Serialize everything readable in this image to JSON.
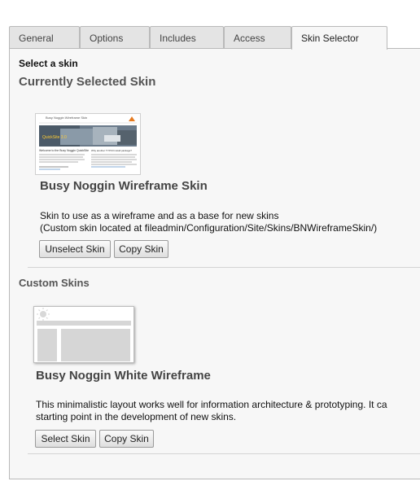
{
  "tabs": [
    {
      "label": "General",
      "active": false
    },
    {
      "label": "Options",
      "active": false
    },
    {
      "label": "Includes",
      "active": false
    },
    {
      "label": "Access",
      "active": false
    },
    {
      "label": "Skin Selector",
      "active": true
    }
  ],
  "panel": {
    "select_label": "Select a skin",
    "current_heading": "Currently Selected Skin",
    "current_skin": {
      "title": "Busy Noggin Wireframe Skin",
      "description_line1": "Skin to use as a wireframe and as a base for new skins",
      "description_line2": "(Custom skin located at fileadmin/Configuration/Site/Skins/BNWireframeSkin/)",
      "unselect_label": "Unselect Skin",
      "copy_label": "Copy Skin",
      "thumb_site_title": "Busy Noggin Wireframe Skin",
      "thumb_welcome": "Welcome to the Busy Noggin QuickSite",
      "thumb_sidebar_title": "Why another TYPO3 install package?"
    },
    "custom_heading": "Custom Skins",
    "custom_skin": {
      "title": "Busy Noggin White Wireframe",
      "description_line1": "This minimalistic layout works well for information architecture & prototyping. It ca",
      "description_line2": "starting point in the development of new skins.",
      "select_label": "Select Skin",
      "copy_label": "Copy Skin"
    }
  },
  "colors": {
    "panel_bg": "#f7f7f7",
    "tab_bg": "#e4e4e4",
    "border": "#b9b9b9",
    "heading": "#555555"
  }
}
